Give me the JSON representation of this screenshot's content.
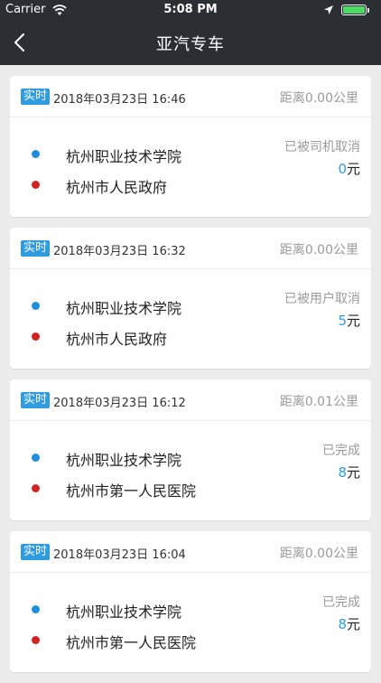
{
  "status_bar": {
    "carrier": "Carrier",
    "time": "5:08 PM"
  },
  "nav": {
    "title": "亚汽专车"
  },
  "colors": {
    "nav_bg": "#2b2e33",
    "accent_blue": "#2f9be0",
    "start_dot": "#1d8fde",
    "end_dot": "#d22323",
    "battery": "#4cd964"
  },
  "orders": [
    {
      "tag": "实时",
      "time": "2018年03月23日 16:46",
      "distance": "距离0.00公里",
      "start": "杭州职业技术学院",
      "end": "杭州市人民政府",
      "status": "已被司机取消",
      "price": "0",
      "unit": "元"
    },
    {
      "tag": "实时",
      "time": "2018年03月23日 16:32",
      "distance": "距离0.00公里",
      "start": "杭州职业技术学院",
      "end": "杭州市人民政府",
      "status": "已被用户取消",
      "price": "5",
      "unit": "元"
    },
    {
      "tag": "实时",
      "time": "2018年03月23日 16:12",
      "distance": "距离0.01公里",
      "start": "杭州职业技术学院",
      "end": "杭州市第一人民医院",
      "status": "已完成",
      "price": "8",
      "unit": "元"
    },
    {
      "tag": "实时",
      "time": "2018年03月23日 16:04",
      "distance": "距离0.00公里",
      "start": "杭州职业技术学院",
      "end": "杭州市第一人民医院",
      "status": "已完成",
      "price": "8",
      "unit": "元"
    }
  ]
}
